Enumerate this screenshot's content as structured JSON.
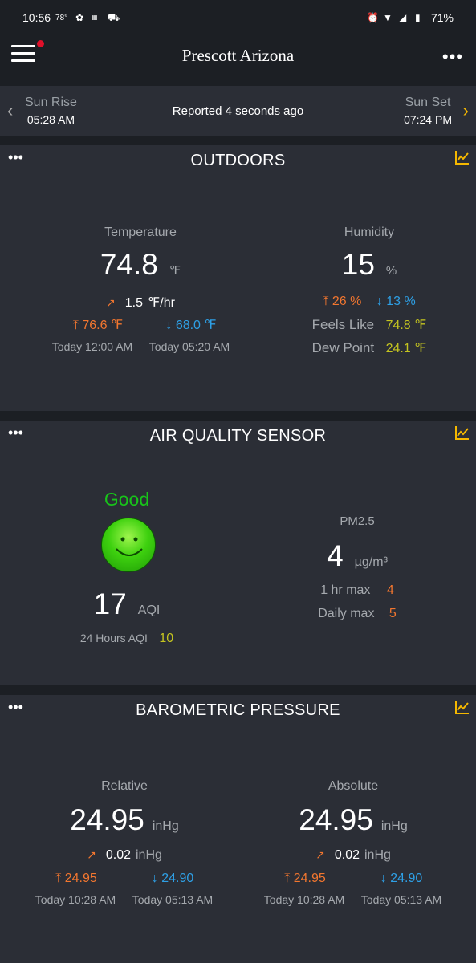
{
  "status_bar": {
    "time": "10:56",
    "temp": "78°",
    "battery": "71%"
  },
  "app_bar": {
    "title": "Prescott Arizona"
  },
  "sun": {
    "rise_label": "Sun Rise",
    "rise_time": "05:28 AM",
    "reported": "Reported 4 seconds ago",
    "set_label": "Sun Set",
    "set_time": "07:24 PM"
  },
  "outdoors": {
    "title": "OUTDOORS",
    "temperature": {
      "label": "Temperature",
      "value": "74.8",
      "unit": "℉",
      "rate": "1.5",
      "rate_unit": "℉/hr",
      "high": "76.6 ℉",
      "low": "68.0 ℉",
      "high_time": "Today 12:00 AM",
      "low_time": "Today 05:20 AM"
    },
    "humidity": {
      "label": "Humidity",
      "value": "15",
      "unit": "%",
      "high": "26 %",
      "low": "13 %",
      "feels_like_label": "Feels Like",
      "feels_like": "74.8 ℉",
      "dew_point_label": "Dew Point",
      "dew_point": "24.1 ℉"
    }
  },
  "air_quality": {
    "title": "AIR QUALITY SENSOR",
    "status": "Good",
    "aqi": "17",
    "aqi_unit": "AQI",
    "aqi_24h_label": "24 Hours AQI",
    "aqi_24h": "10",
    "pm_label": "PM2.5",
    "pm_value": "4",
    "pm_unit": "µg/m³",
    "hr_max_label": "1 hr max",
    "hr_max": "4",
    "daily_max_label": "Daily max",
    "daily_max": "5"
  },
  "pressure": {
    "title": "BAROMETRIC PRESSURE",
    "relative": {
      "label": "Relative",
      "value": "24.95",
      "unit": "inHg",
      "rate": "0.02",
      "rate_unit": "inHg",
      "high": "24.95",
      "low": "24.90",
      "high_time": "Today 10:28 AM",
      "low_time": "Today 05:13 AM"
    },
    "absolute": {
      "label": "Absolute",
      "value": "24.95",
      "unit": "inHg",
      "rate": "0.02",
      "rate_unit": "inHg",
      "high": "24.95",
      "low": "24.90",
      "high_time": "Today 10:28 AM",
      "low_time": "Today 05:13 AM"
    }
  },
  "colors": {
    "background": "#1c1f24",
    "card": "#2b2e36",
    "accent": "#f5b800",
    "high": "#f2762f",
    "low": "#2ea0e6",
    "good": "#18c41a"
  }
}
